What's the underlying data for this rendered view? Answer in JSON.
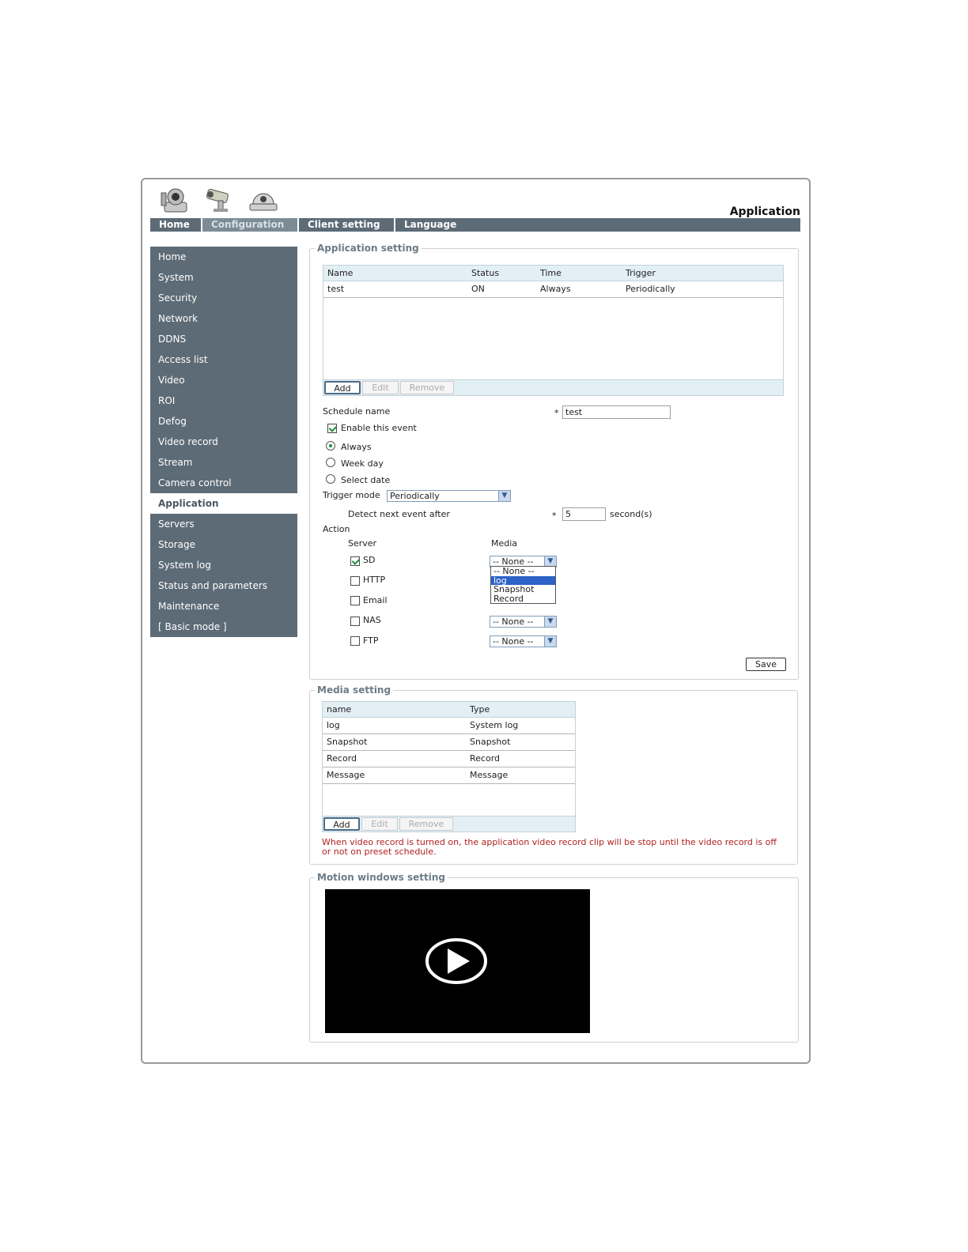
{
  "header": {
    "page_label": "Application",
    "logos": [
      "ptz-camera-icon",
      "bullet-camera-icon",
      "dome-camera-icon"
    ]
  },
  "topnav": {
    "tabs": [
      {
        "label": "Home"
      },
      {
        "label": "Configuration",
        "active": true
      },
      {
        "label": "Client setting"
      },
      {
        "label": "Language"
      }
    ]
  },
  "sidebar": {
    "items": [
      {
        "label": "Home"
      },
      {
        "label": "System"
      },
      {
        "label": "Security"
      },
      {
        "label": "Network"
      },
      {
        "label": "DDNS"
      },
      {
        "label": "Access list"
      },
      {
        "label": "Video"
      },
      {
        "label": "ROI"
      },
      {
        "label": "Defog"
      },
      {
        "label": "Video record"
      },
      {
        "label": "Stream"
      },
      {
        "label": "Camera control"
      },
      {
        "label": "Application",
        "active": true
      },
      {
        "label": "Servers"
      },
      {
        "label": "Storage"
      },
      {
        "label": "System log"
      },
      {
        "label": "Status and parameters"
      },
      {
        "label": "Maintenance"
      },
      {
        "label": "[ Basic mode ]"
      }
    ]
  },
  "app_setting": {
    "legend": "Application setting",
    "columns": [
      "Name",
      "Status",
      "Time",
      "Trigger"
    ],
    "rows": [
      [
        "test",
        "ON",
        "Always",
        "Periodically"
      ]
    ],
    "buttons": {
      "add": "Add",
      "edit": "Edit",
      "remove": "Remove"
    },
    "schedule_name_label": "Schedule name",
    "required_mark": "*",
    "schedule_name_value": "test",
    "enable_label": "Enable this event",
    "enable_checked": true,
    "time_options": [
      {
        "label": "Always",
        "checked": true
      },
      {
        "label": "Week day",
        "checked": false
      },
      {
        "label": "Select date",
        "checked": false
      }
    ],
    "trigger_mode_label": "Trigger mode",
    "trigger_mode_value": "Periodically",
    "detect_label": "Detect next event after",
    "detect_value": "5",
    "detect_unit": "second(s)",
    "action_label": "Action",
    "server_header": "Server",
    "media_header": "Media",
    "servers": [
      {
        "label": "SD",
        "checked": true,
        "media": "-- None --"
      },
      {
        "label": "HTTP",
        "checked": false,
        "media": ""
      },
      {
        "label": "Email",
        "checked": false,
        "media": ""
      },
      {
        "label": "NAS",
        "checked": false,
        "media": "-- None --"
      },
      {
        "label": "FTP",
        "checked": false,
        "media": "-- None --"
      }
    ],
    "dropdown_options": [
      "-- None --",
      "log",
      "Snapshot",
      "Record"
    ],
    "dropdown_highlighted": "log",
    "save_label": "Save"
  },
  "media_setting": {
    "legend": "Media setting",
    "columns": [
      "name",
      "Type"
    ],
    "rows": [
      [
        "log",
        "System log"
      ],
      [
        "Snapshot",
        "Snapshot"
      ],
      [
        "Record",
        "Record"
      ],
      [
        "Message",
        "Message"
      ]
    ],
    "buttons": {
      "add": "Add",
      "edit": "Edit",
      "remove": "Remove"
    },
    "note": "When video record is turned on, the application video record clip will be stop until the video record is off or not on preset schedule."
  },
  "motion_setting": {
    "legend": "Motion windows setting"
  },
  "colors": {
    "nav_bg": "#5d6b76",
    "header_row_bg": "#e2eff5",
    "note_text": "#b02020",
    "check_green": "#1d8a3a"
  }
}
